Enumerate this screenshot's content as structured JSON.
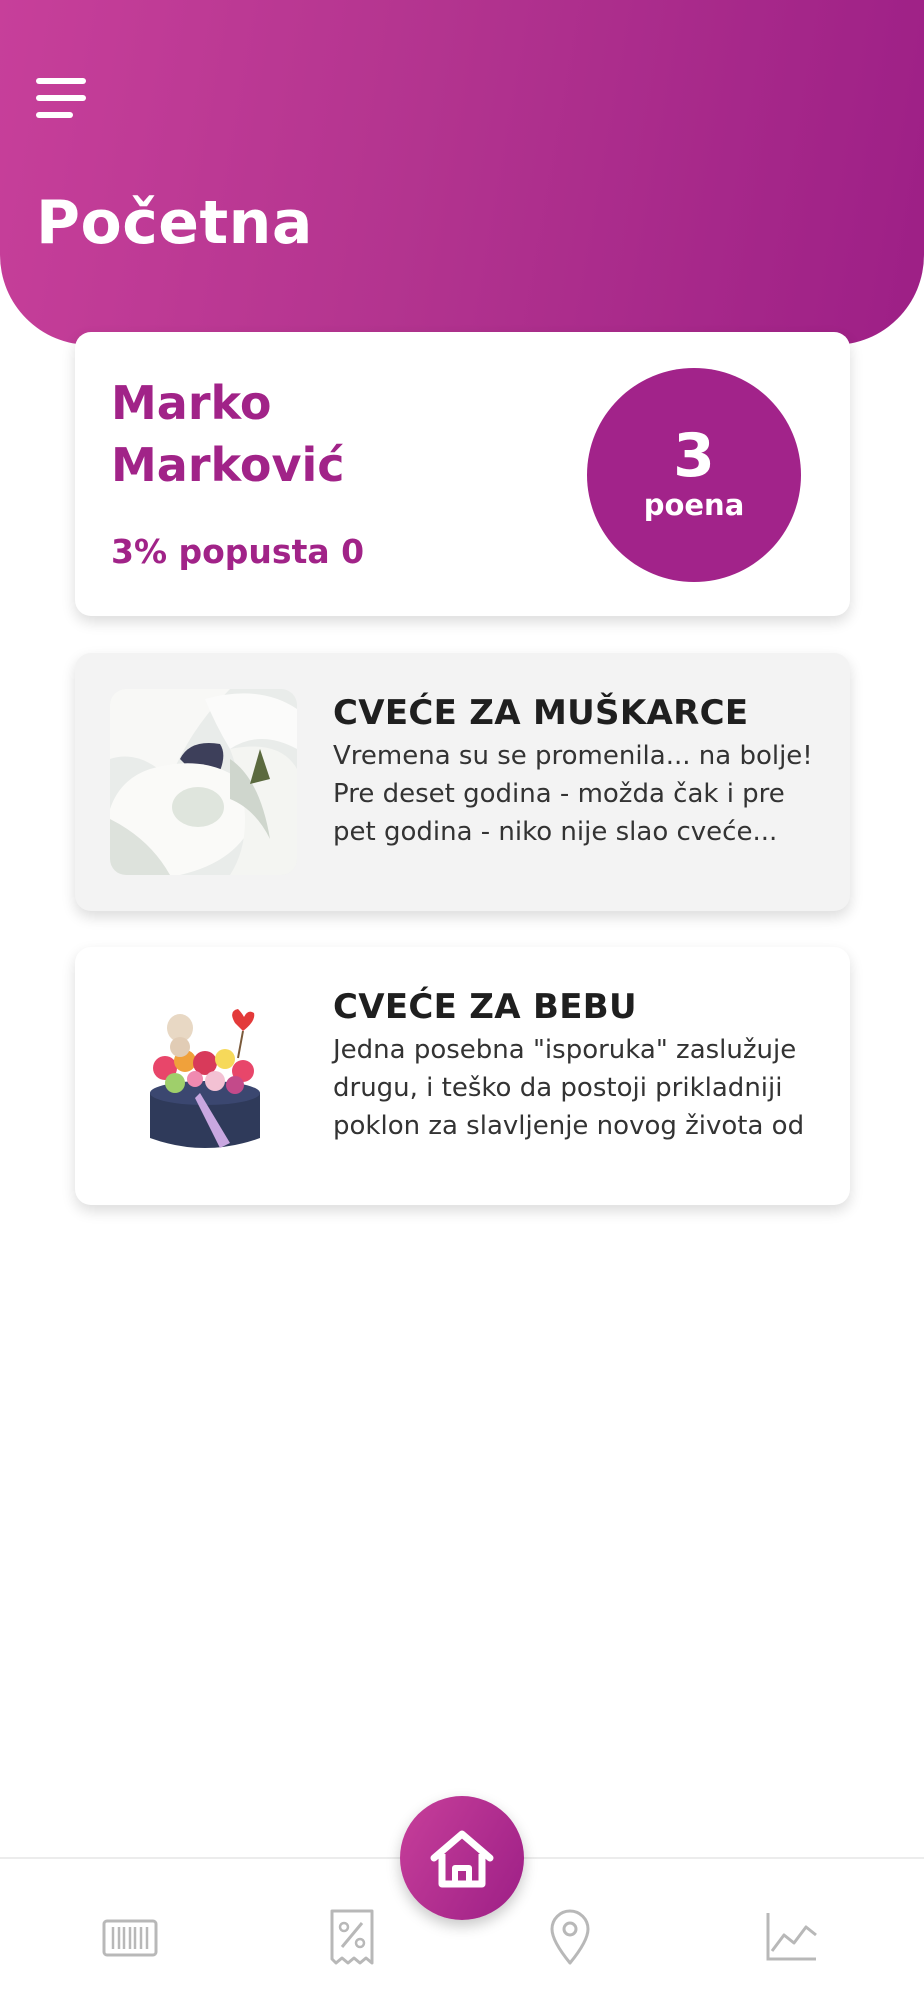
{
  "header": {
    "title": "Početna",
    "gradient": [
      "#c73f9a",
      "#9d1f86"
    ]
  },
  "profile": {
    "name_line1": "Marko",
    "name_line2": "Marković",
    "discount_text": "3% popusta 0",
    "points_value": "3",
    "points_label": "poena",
    "accent_color": "#a12388"
  },
  "articles": [
    {
      "title": "CVEĆE ZA MUŠKARCE",
      "excerpt": "Vremena su se promenila... na bolje! Pre deset godina - možda čak i pre pet godina - niko nije slao cveće...",
      "image": "white-calla-lilies"
    },
    {
      "title": "CVEĆE ZA BEBU",
      "excerpt": "Jedna posebna \"isporuka\" zaslužuje drugu, i teško da postoji prikladniji poklon za slavljenje novog života od",
      "image": "flower-box-with-teddy"
    }
  ],
  "bottom_nav": {
    "items": [
      "barcode-icon",
      "discount-icon",
      "location-pin-icon",
      "chart-icon"
    ],
    "active": "home-icon"
  }
}
